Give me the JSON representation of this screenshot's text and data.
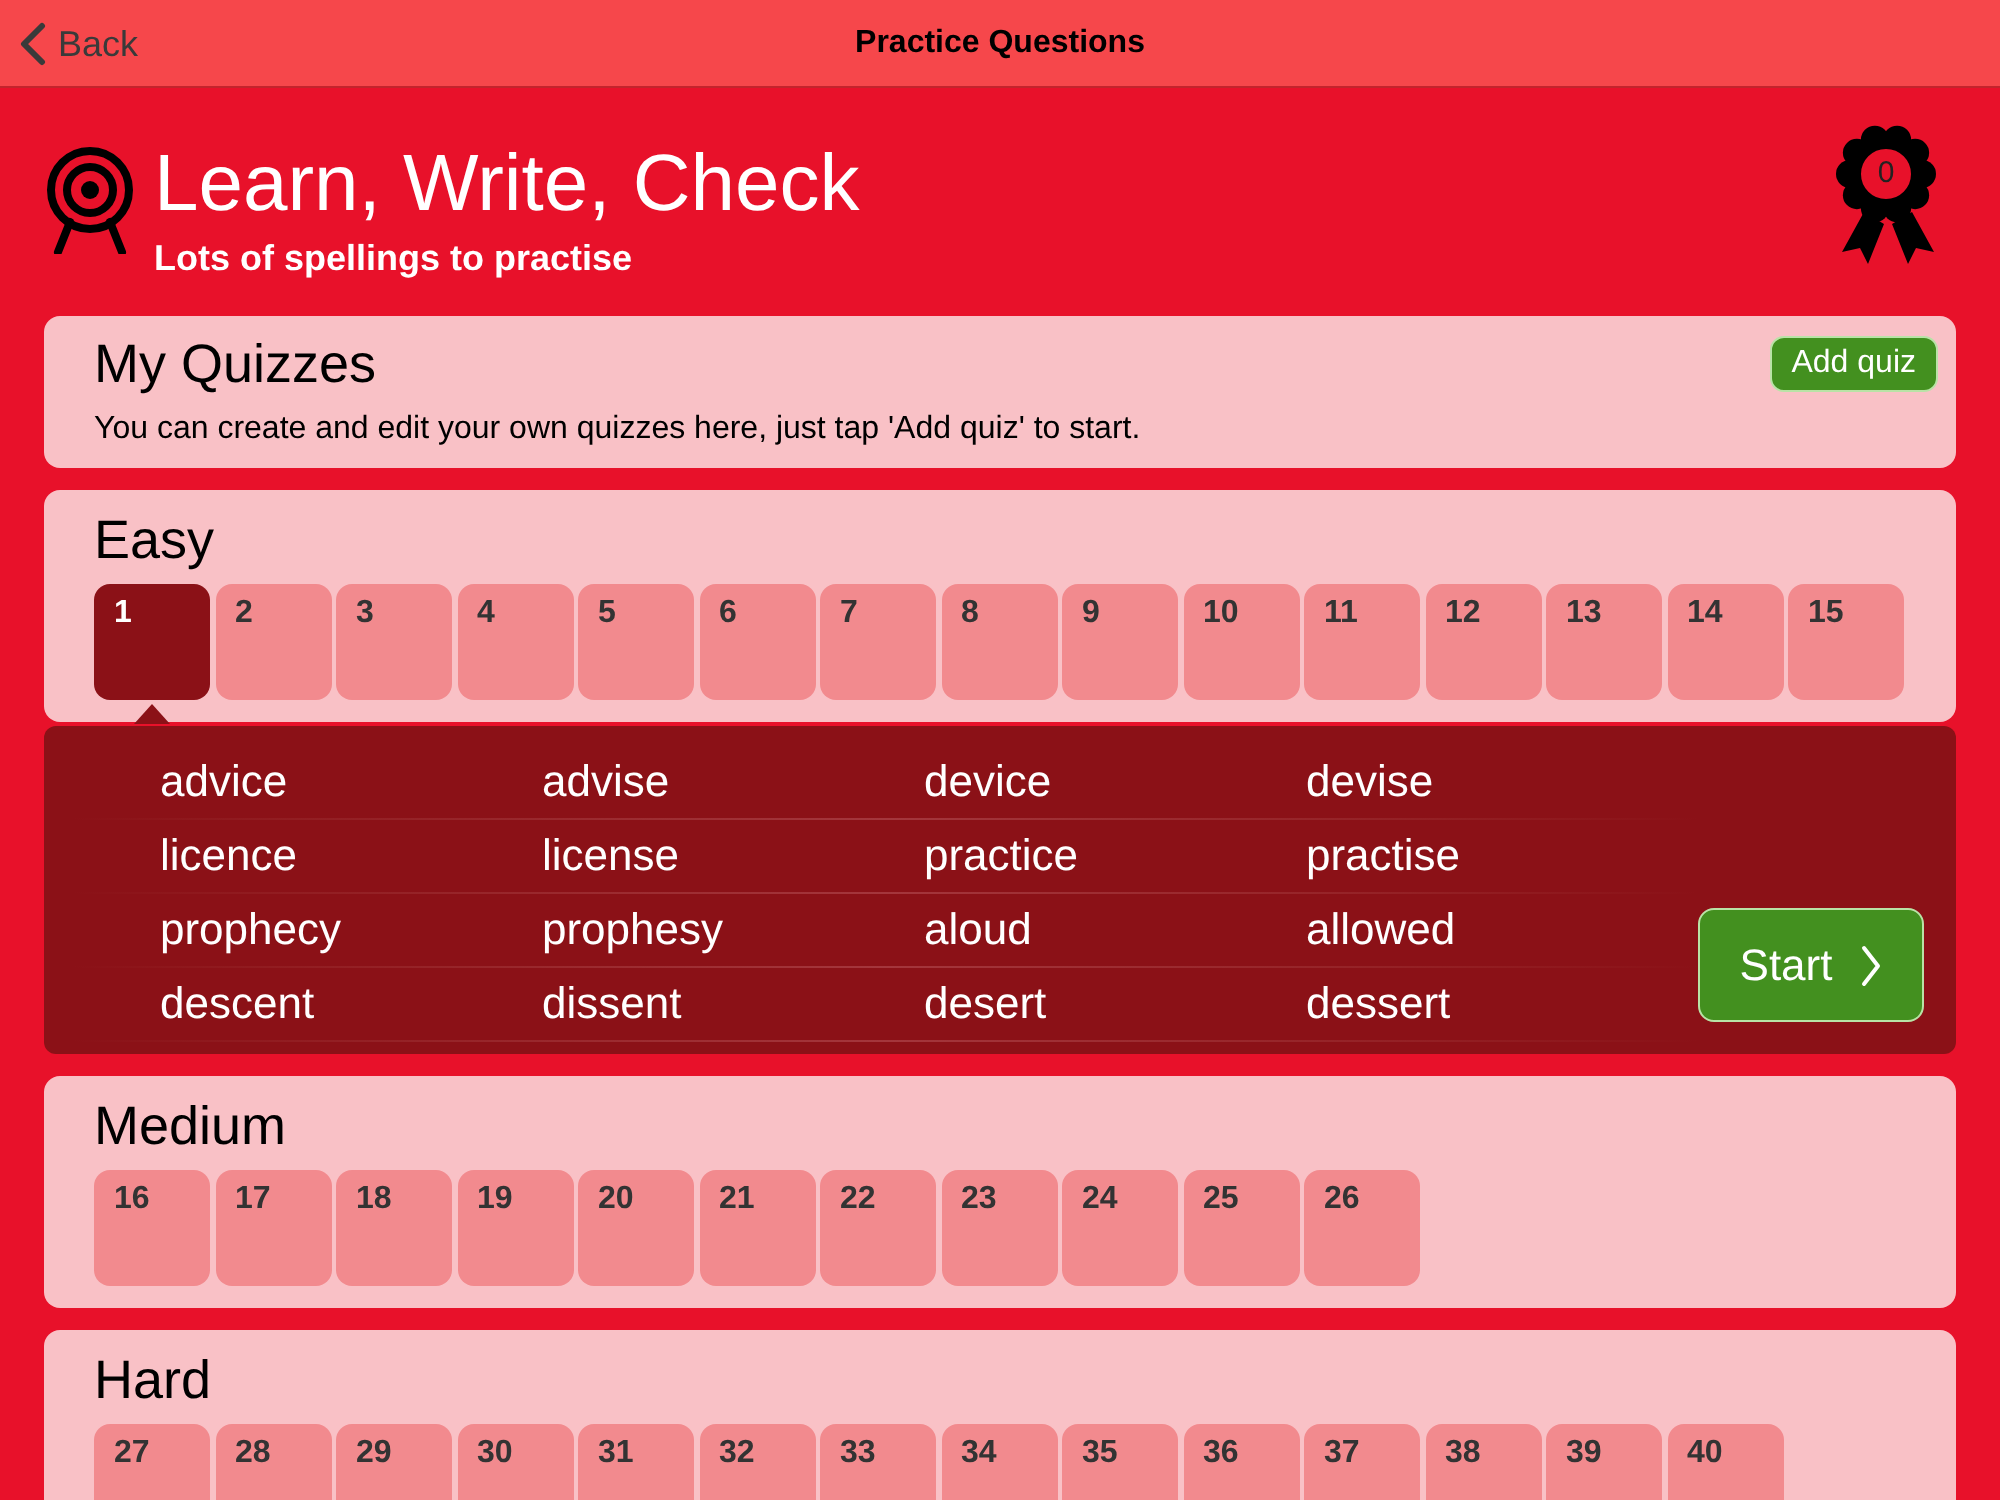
{
  "nav_bar": {
    "back_label": "Back",
    "title": "Practice Questions"
  },
  "header": {
    "title": "Learn, Write, Check",
    "subtitle": "Lots of spellings to practise",
    "award_count": "0"
  },
  "my_quizzes": {
    "title": "My Quizzes",
    "description": "You can create and edit your own quizzes here, just tap 'Add quiz' to start.",
    "add_button": "Add quiz"
  },
  "levels": [
    {
      "title": "Easy",
      "quizzes": [
        {
          "number": "1",
          "selected": true
        },
        {
          "number": "2",
          "selected": false
        },
        {
          "number": "3",
          "selected": false
        },
        {
          "number": "4",
          "selected": false
        },
        {
          "number": "5",
          "selected": false
        },
        {
          "number": "6",
          "selected": false
        },
        {
          "number": "7",
          "selected": false
        },
        {
          "number": "8",
          "selected": false
        },
        {
          "number": "9",
          "selected": false
        },
        {
          "number": "10",
          "selected": false
        },
        {
          "number": "11",
          "selected": false
        },
        {
          "number": "12",
          "selected": false
        },
        {
          "number": "13",
          "selected": false
        },
        {
          "number": "14",
          "selected": false
        },
        {
          "number": "15",
          "selected": false
        }
      ],
      "word_list": {
        "rows": [
          [
            "advice",
            "advise",
            "device",
            "devise"
          ],
          [
            "licence",
            "license",
            "practice",
            "practise"
          ],
          [
            "prophecy",
            "prophesy",
            "aloud",
            "allowed"
          ],
          [
            "descent",
            "dissent",
            "desert",
            "dessert"
          ]
        ],
        "start_button": "Start"
      }
    },
    {
      "title": "Medium",
      "quizzes": [
        {
          "number": "16",
          "selected": false
        },
        {
          "number": "17",
          "selected": false
        },
        {
          "number": "18",
          "selected": false
        },
        {
          "number": "19",
          "selected": false
        },
        {
          "number": "20",
          "selected": false
        },
        {
          "number": "21",
          "selected": false
        },
        {
          "number": "22",
          "selected": false
        },
        {
          "number": "23",
          "selected": false
        },
        {
          "number": "24",
          "selected": false
        },
        {
          "number": "25",
          "selected": false
        },
        {
          "number": "26",
          "selected": false
        }
      ]
    },
    {
      "title": "Hard",
      "quizzes": [
        {
          "number": "27",
          "selected": false
        },
        {
          "number": "28",
          "selected": false
        },
        {
          "number": "29",
          "selected": false
        },
        {
          "number": "30",
          "selected": false
        },
        {
          "number": "31",
          "selected": false
        },
        {
          "number": "32",
          "selected": false
        },
        {
          "number": "33",
          "selected": false
        },
        {
          "number": "34",
          "selected": false
        },
        {
          "number": "35",
          "selected": false
        },
        {
          "number": "36",
          "selected": false
        },
        {
          "number": "37",
          "selected": false
        },
        {
          "number": "38",
          "selected": false
        },
        {
          "number": "39",
          "selected": false
        },
        {
          "number": "40",
          "selected": false
        }
      ]
    }
  ]
}
